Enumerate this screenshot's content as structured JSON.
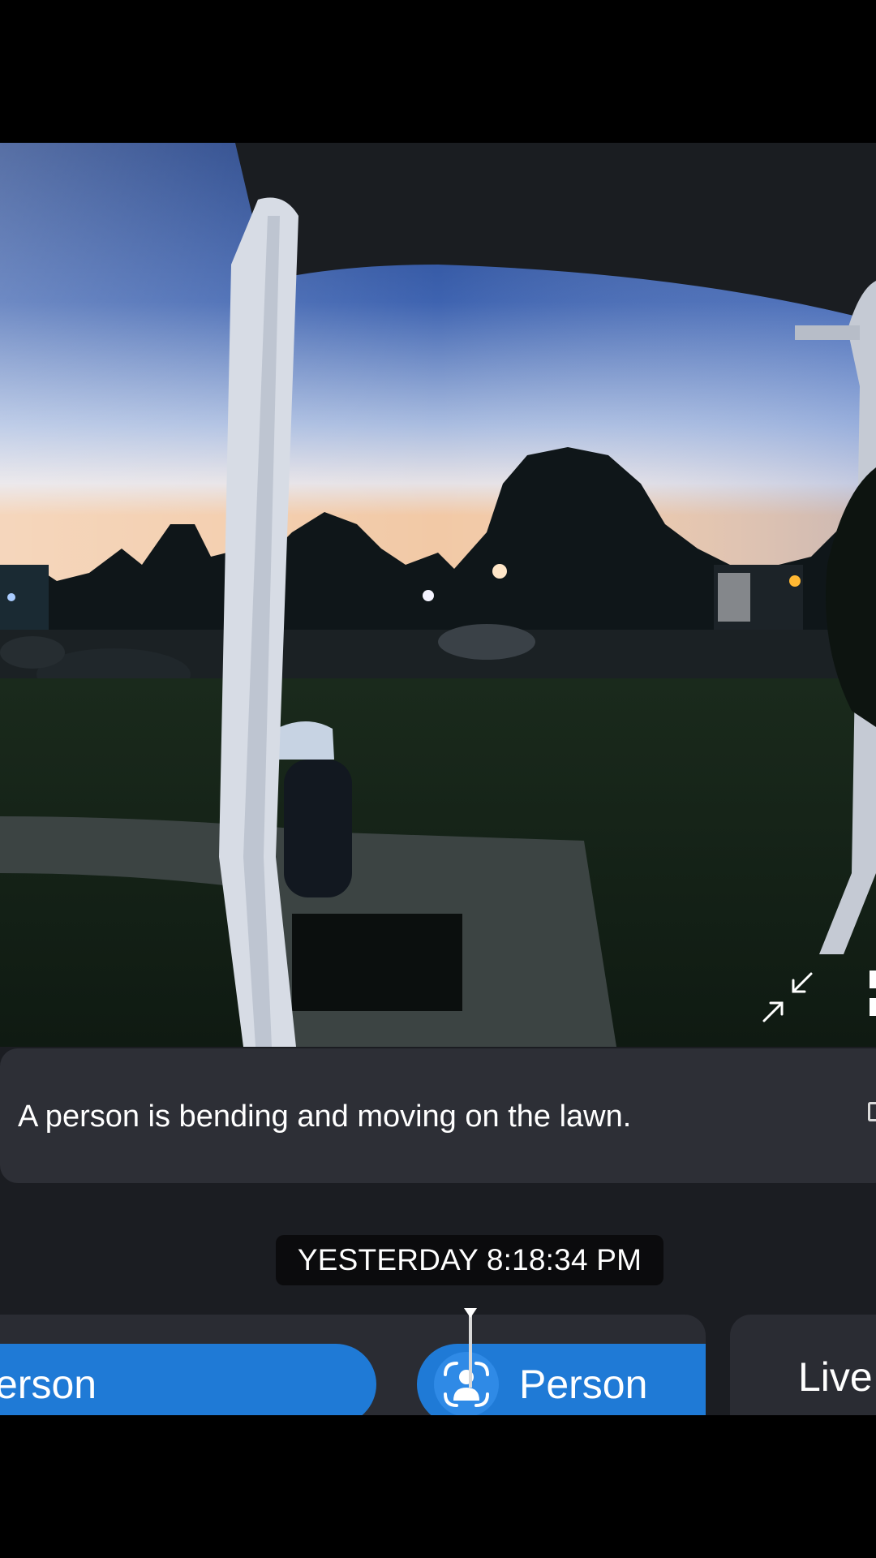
{
  "camera": {
    "scene_icon": "doorbell-camera-feed"
  },
  "controls": {
    "collapse_icon": "collapse-arrows-icon"
  },
  "caption": {
    "text": "A person is bending and moving on the lawn."
  },
  "timestamp": {
    "text": "YESTERDAY 8:18:34 PM"
  },
  "timeline": {
    "events": [
      {
        "label": "erson",
        "color": "#1f7ad6"
      },
      {
        "label": "Person",
        "icon": "person-detect-icon",
        "color": "#1f7ad6"
      }
    ],
    "live_label": "Live"
  },
  "colors": {
    "accent": "#1f7ad6",
    "panel": "#1b1d22",
    "card": "#2d2f36"
  }
}
